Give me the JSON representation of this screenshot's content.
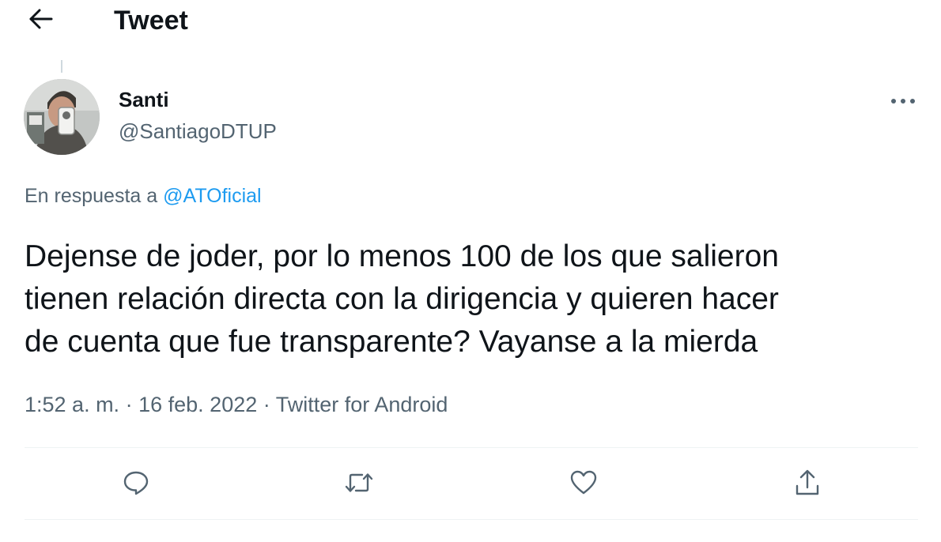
{
  "header": {
    "title": "Tweet",
    "back_icon": "arrow-left-icon"
  },
  "tweet": {
    "author": {
      "display_name": "Santi",
      "handle": "@SantiagoDTUP"
    },
    "reply_to": {
      "prefix": "En respuesta a",
      "mention": "@ATOficial"
    },
    "text_lines": [
      "Dejense de joder, por lo menos 100 de los que salieron",
      "tienen relación directa con la dirigencia y quieren hacer",
      "de cuenta que fue transparente? Vayanse a la mierda"
    ],
    "meta": {
      "time": "1:52 a. m.",
      "separator": "·",
      "date": "16 feb. 2022",
      "source": "Twitter for Android"
    }
  },
  "actions": [
    {
      "name": "reply",
      "icon": "reply-icon"
    },
    {
      "name": "retweet",
      "icon": "retweet-icon"
    },
    {
      "name": "like",
      "icon": "heart-icon"
    },
    {
      "name": "share",
      "icon": "share-icon"
    }
  ],
  "colors": {
    "text_primary": "#0f1419",
    "text_secondary": "#536471",
    "link": "#1d9bf0",
    "divider": "#eff3f4"
  }
}
